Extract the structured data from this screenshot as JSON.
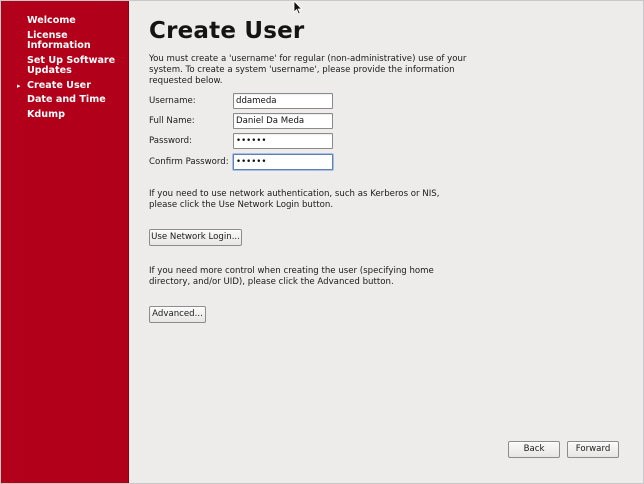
{
  "sidebar": {
    "items": [
      {
        "label": "Welcome",
        "current": false
      },
      {
        "label": "License Information",
        "current": false
      },
      {
        "label": "Set Up Software Updates",
        "current": false
      },
      {
        "label": "Create User",
        "current": true
      },
      {
        "label": "Date and Time",
        "current": false
      },
      {
        "label": "Kdump",
        "current": false
      }
    ],
    "current_marker": "▸"
  },
  "main": {
    "title": "Create User",
    "intro": "You must create a 'username' for regular (non-administrative) use of your system.  To create a system 'username', please provide the information requested below.",
    "form": {
      "username": {
        "label": "Username:",
        "value": "ddameda"
      },
      "full_name": {
        "label": "Full Name:",
        "value": "Daniel Da Meda"
      },
      "password": {
        "label": "Password:",
        "value": "••••••"
      },
      "confirm_password": {
        "label": "Confirm Password:",
        "value": "••••••"
      }
    },
    "network_text": "If you need to use network authentication, such as Kerberos or NIS, please click the Use Network Login button.",
    "network_button": "Use Network Login...",
    "advanced_text": "If you need more control when creating the user (specifying home directory, and/or UID), please click the Advanced button.",
    "advanced_button": "Advanced..."
  },
  "footer": {
    "back_label": "Back",
    "forward_label": "Forward"
  },
  "colors": {
    "sidebar_bg": "#b3001b",
    "window_bg": "#edecea",
    "focus_border": "#5c7fb8"
  },
  "icons": {
    "pointer": "mouse-pointer-icon",
    "current_step": "triangle-right-icon"
  }
}
